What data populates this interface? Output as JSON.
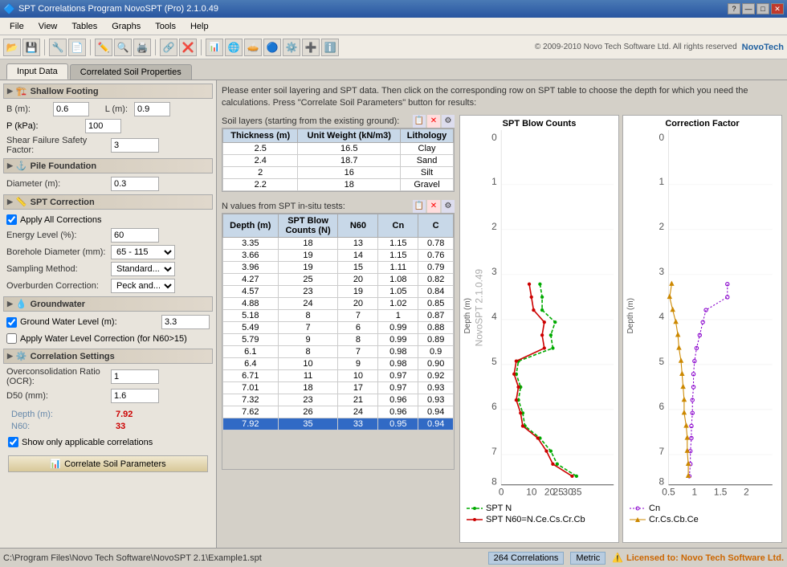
{
  "titlebar": {
    "title": "SPT Correlations Program NovoSPT (Pro) 2.1.0.49",
    "btns": [
      "?",
      "—",
      "□",
      "✕"
    ]
  },
  "menubar": {
    "items": [
      "File",
      "View",
      "Tables",
      "Graphs",
      "Tools",
      "Help"
    ]
  },
  "toolbar": {
    "copyright": "© 2009-2010 Novo Tech Software Ltd. All rights reserved",
    "icons": [
      "📂",
      "💾",
      "🔧",
      "📄",
      "✏️",
      "🔍",
      "🖨️",
      "🔗",
      "❌",
      "📊",
      "📈",
      "🌐",
      "⚙️",
      "ℹ️",
      "❓"
    ]
  },
  "tabs": {
    "items": [
      "Input Data",
      "Correlated Soil Properties"
    ],
    "active": 0
  },
  "instructions": "Please enter soil layering and SPT data. Then click on the corresponding row on SPT table to choose the depth for which you need the calculations. Press \"Correlate Soil Parameters\" button for results:",
  "shallow_footing": {
    "label": "Shallow Footing",
    "B_label": "B (m):",
    "B_value": "0.6",
    "L_label": "L (m):",
    "L_value": "0.9",
    "P_label": "P (kPa):",
    "P_value": "100",
    "shear_label": "Shear Failure Safety Factor:",
    "shear_value": "3"
  },
  "pile_foundation": {
    "label": "Pile Foundation",
    "diameter_label": "Diameter (m):",
    "diameter_value": "0.3"
  },
  "spt_correction": {
    "label": "SPT Correction",
    "apply_all": "Apply All Corrections",
    "apply_all_checked": true,
    "energy_label": "Energy Level (%):",
    "energy_value": "60",
    "borehole_label": "Borehole Diameter (mm):",
    "borehole_value": "65 - 115",
    "sampling_label": "Sampling Method:",
    "sampling_value": "Standard...",
    "overburden_label": "Overburden Correction:",
    "overburden_value": "Peck and..."
  },
  "groundwater": {
    "label": "Groundwater",
    "gwl_label": "Ground Water Level (m):",
    "gwl_value": "3.3",
    "gwl_checked": true,
    "water_correction": "Apply Water Level Correction (for N60>15)",
    "water_correction_checked": false
  },
  "correlation_settings": {
    "label": "Correlation Settings",
    "ocr_label": "Overconsolidation Ratio (OCR):",
    "ocr_value": "1",
    "d50_label": "D50 (mm):",
    "d50_value": "1.6"
  },
  "depth_display": {
    "depth_label": "Depth (m):",
    "depth_value": "7.92",
    "n60_label": "N60:",
    "n60_value": "33"
  },
  "show_applicable": {
    "label": "Show only applicable correlations",
    "checked": true
  },
  "correlate_btn": "Correlate Soil Parameters",
  "soil_layers": {
    "header": "Soil layers (starting from the existing ground):",
    "columns": [
      "Thickness (m)",
      "Unit Weight (kN/m3)",
      "Lithology"
    ],
    "rows": [
      {
        "thickness": "2.5",
        "unit_weight": "16.5",
        "lithology": "Clay"
      },
      {
        "thickness": "2.4",
        "unit_weight": "18.7",
        "lithology": "Sand"
      },
      {
        "thickness": "2",
        "unit_weight": "16",
        "lithology": "Silt"
      },
      {
        "thickness": "2.2",
        "unit_weight": "18",
        "lithology": "Gravel"
      }
    ]
  },
  "spt_data": {
    "header": "N values from SPT in-situ tests:",
    "columns": [
      "Depth (m)",
      "SPT Blow Counts (N)",
      "N60",
      "Cn",
      "C"
    ],
    "rows": [
      {
        "depth": "3.35",
        "n": "18",
        "n60": "13",
        "cn": "1.15",
        "c": "0.78"
      },
      {
        "depth": "3.66",
        "n": "19",
        "n60": "14",
        "cn": "1.15",
        "c": "0.76"
      },
      {
        "depth": "3.96",
        "n": "19",
        "n60": "15",
        "cn": "1.11",
        "c": "0.79"
      },
      {
        "depth": "4.27",
        "n": "25",
        "n60": "20",
        "cn": "1.08",
        "c": "0.82",
        "highlight": true
      },
      {
        "depth": "4.57",
        "n": "23",
        "n60": "19",
        "cn": "1.05",
        "c": "0.84"
      },
      {
        "depth": "4.88",
        "n": "24",
        "n60": "20",
        "cn": "1.02",
        "c": "0.85",
        "highlight": true
      },
      {
        "depth": "5.18",
        "n": "8",
        "n60": "7",
        "cn": "1",
        "c": "0.87"
      },
      {
        "depth": "5.49",
        "n": "7",
        "n60": "6",
        "cn": "0.99",
        "c": "0.88"
      },
      {
        "depth": "5.79",
        "n": "9",
        "n60": "8",
        "cn": "0.99",
        "c": "0.89"
      },
      {
        "depth": "6.1",
        "n": "8",
        "n60": "7",
        "cn": "0.98",
        "c": "0.9"
      },
      {
        "depth": "6.4",
        "n": "10",
        "n60": "9",
        "cn": "0.98",
        "c": "0.90"
      },
      {
        "depth": "6.71",
        "n": "11",
        "n60": "10",
        "cn": "0.97",
        "c": "0.92"
      },
      {
        "depth": "7.01",
        "n": "18",
        "n60": "17",
        "cn": "0.97",
        "c": "0.93"
      },
      {
        "depth": "7.32",
        "n": "23",
        "n60": "21",
        "cn": "0.96",
        "c": "0.93"
      },
      {
        "depth": "7.62",
        "n": "26",
        "n60": "24",
        "cn": "0.96",
        "c": "0.94"
      },
      {
        "depth": "7.92",
        "n": "35",
        "n60": "33",
        "cn": "0.95",
        "c": "0.94",
        "selected": true
      }
    ]
  },
  "chart1": {
    "title": "SPT Blow Counts",
    "x_axis": "0  10  20  25  30  35",
    "y_axis": "Depth (m)",
    "legend": [
      {
        "label": "SPT N",
        "color": "#008000",
        "style": "dashed"
      },
      {
        "label": "SPT N60=N.Ce.Cs.Cr.Cb",
        "color": "#cc0000",
        "style": "solid"
      }
    ]
  },
  "chart2": {
    "title": "Correction Factor",
    "x_axis": "0.5  1  1.5  2",
    "y_axis": "Depth (m)",
    "legend": [
      {
        "label": "Cn",
        "color": "#8800cc",
        "style": "dotted"
      },
      {
        "label": "Cr.Cs.Cb.Ce",
        "color": "#cc8800",
        "style": "triangle"
      }
    ]
  },
  "statusbar": {
    "path": "C:\\Program Files\\Novo Tech Software\\NovoSPT 2.1\\Example1.spt",
    "correlations": "264 Correlations",
    "metric": "Metric",
    "license": "Licensed to: Novo Tech Software Ltd."
  }
}
